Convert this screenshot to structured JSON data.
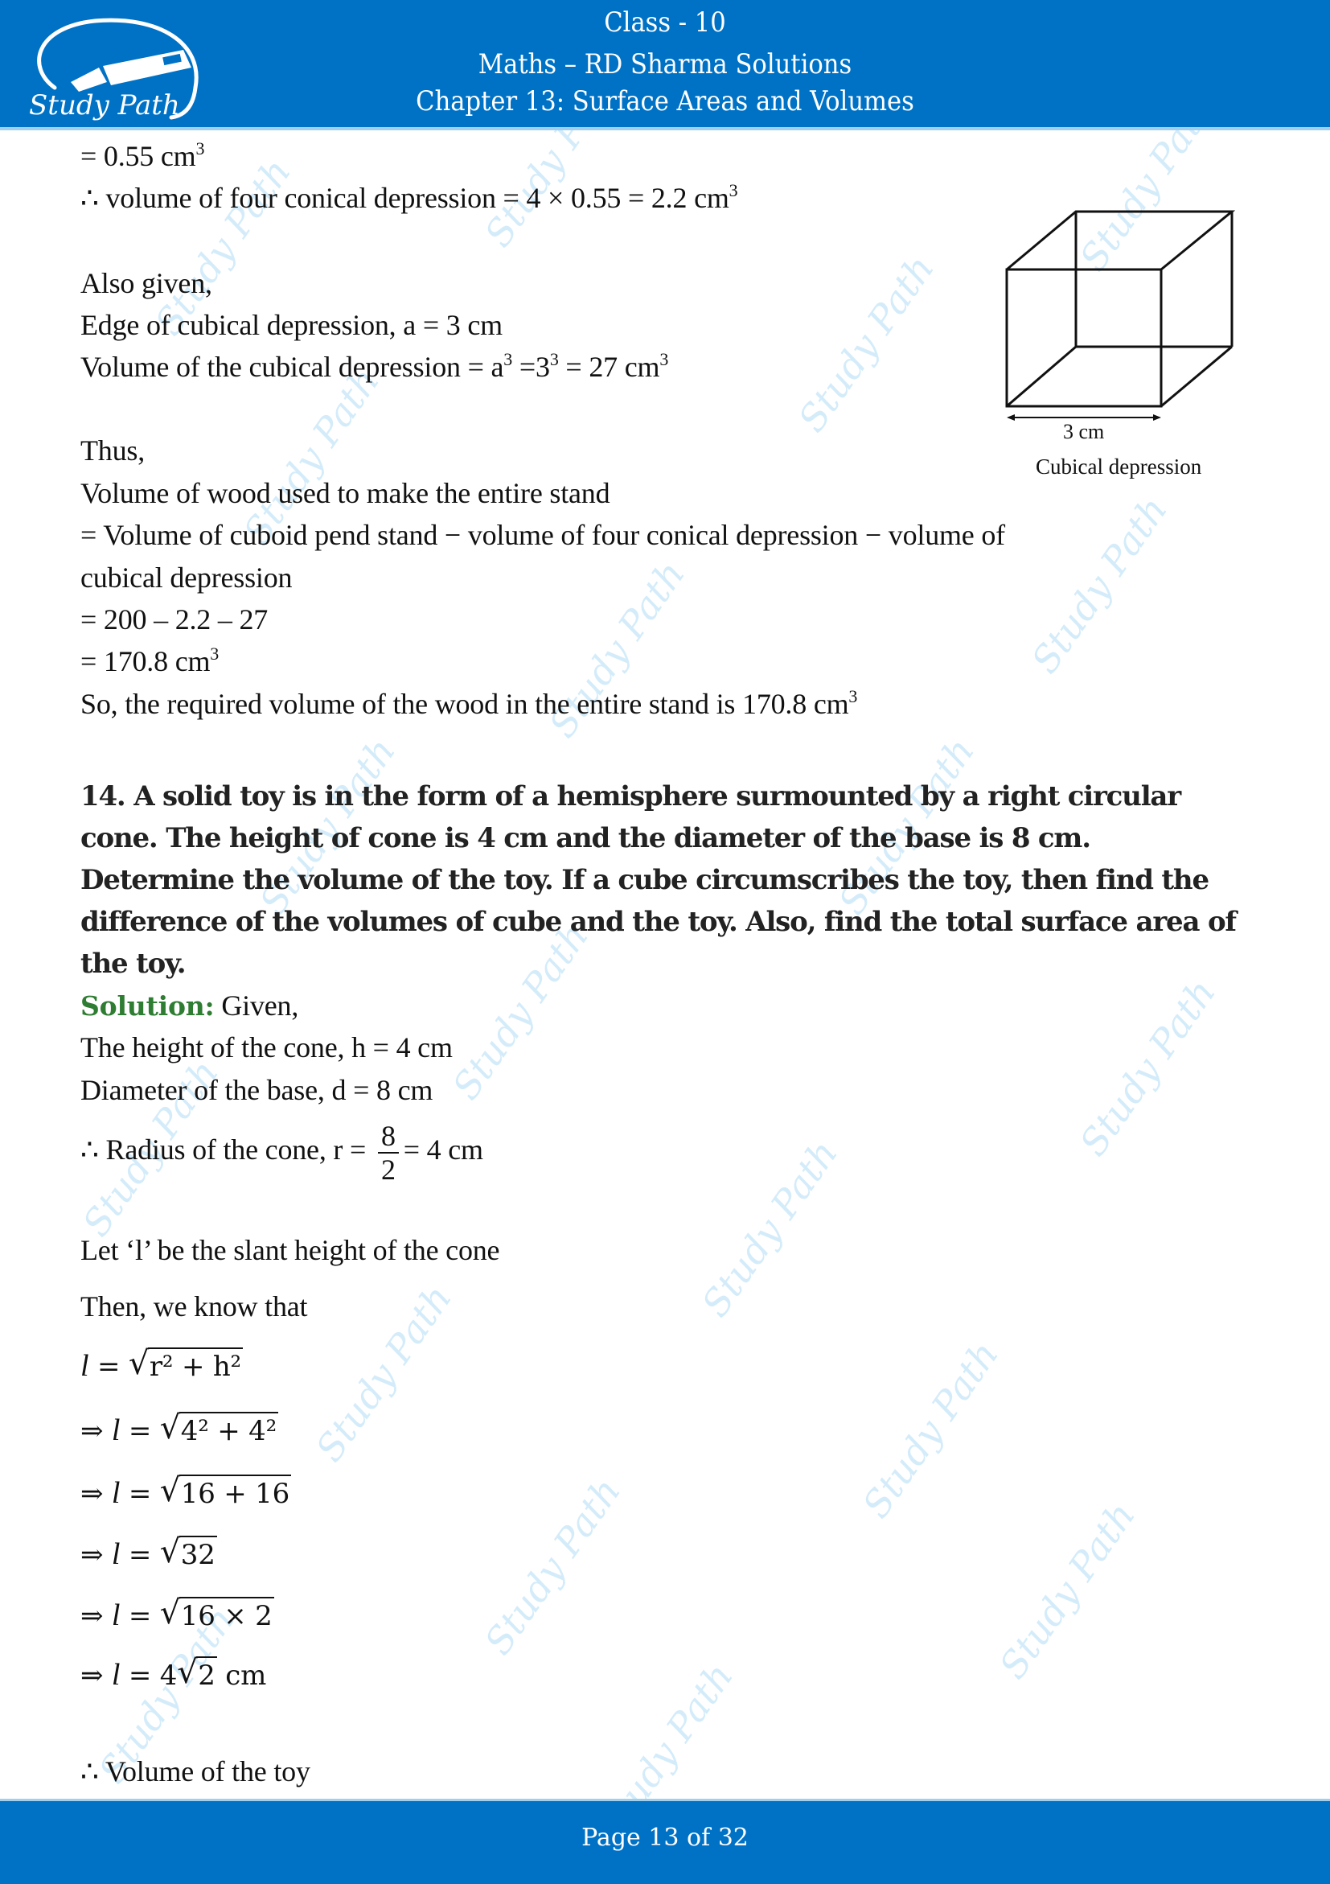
{
  "header": {
    "logo_text": "Study Path",
    "class_line": "Class - 10",
    "subject_line": "Maths – RD Sharma Solutions",
    "chapter_line": "Chapter 13: Surface Areas and Volumes"
  },
  "watermark_text": "Study Path",
  "content": {
    "lines_top": [
      "= 0.55 cm",
      "∴ volume of four conical depression = 4 × 0.55 = 2.2 cm",
      "Also given,",
      "Edge of cubical depression, a = 3 cm",
      "Volume of the cubical depression = a",
      "Thus,",
      "Volume of wood used to make the entire stand",
      "= Volume of cuboid pend stand − volume of four conical depression − volume of",
      "cubical depression",
      "= 200 – 2.2 – 27",
      "= 170.8 cm",
      "So, the required volume of the wood in the entire stand is 170.8 cm"
    ],
    "cubical_volume_rest": " =3",
    "cubical_volume_end": " = 27 cm",
    "superscript_3": "3",
    "superscript_2": "2",
    "figure": {
      "dimension_label": "3 cm",
      "caption": "Cubical depression"
    },
    "question": "14. A solid toy is in the form of a hemisphere surmounted by a right circular cone. The height of cone is 4 cm and the diameter of the base is 8 cm. Determine the volume of the toy. If a cube circumscribes the toy, then find the difference of the volumes of cube and the toy. Also, find the total surface area of the toy.",
    "solution_label": "Solution:",
    "solution_intro": " Given,",
    "given": [
      "The height of the cone, h = 4 cm",
      "Diameter of the base, d = 8 cm"
    ],
    "radius": {
      "prefix": "∴ Radius of the cone, r = ",
      "numerator": "8",
      "denominator": "2",
      "suffix": "= 4 cm"
    },
    "slant_intro": "Let ‘l’ be the slant height of the cone",
    "then_know": "Then, we know that",
    "steps": [
      {
        "prefix": "",
        "radicand": "r² + h²",
        "suffix": ""
      },
      {
        "prefix": "⇒ ",
        "radicand": "4² + 4²",
        "suffix": ""
      },
      {
        "prefix": "⇒ ",
        "radicand": "16 + 16",
        "suffix": ""
      },
      {
        "prefix": "⇒ ",
        "radicand": "32",
        "suffix": ""
      },
      {
        "prefix": "⇒ ",
        "radicand": "16 × 2",
        "suffix": ""
      },
      {
        "prefix": "⇒ ",
        "coef": "4",
        "radicand": "2",
        "suffix": " cm"
      }
    ],
    "l_symbol": "l",
    "equals": " = ",
    "volume_toy": "∴ Volume of the toy"
  },
  "footer": {
    "page_label": "Page 13 of 32",
    "current_page": 13,
    "total_pages": 32
  },
  "colors": {
    "brand_blue": "#0072c6",
    "solution_green": "#2e7d32",
    "watermark": "#d4ecfa"
  }
}
